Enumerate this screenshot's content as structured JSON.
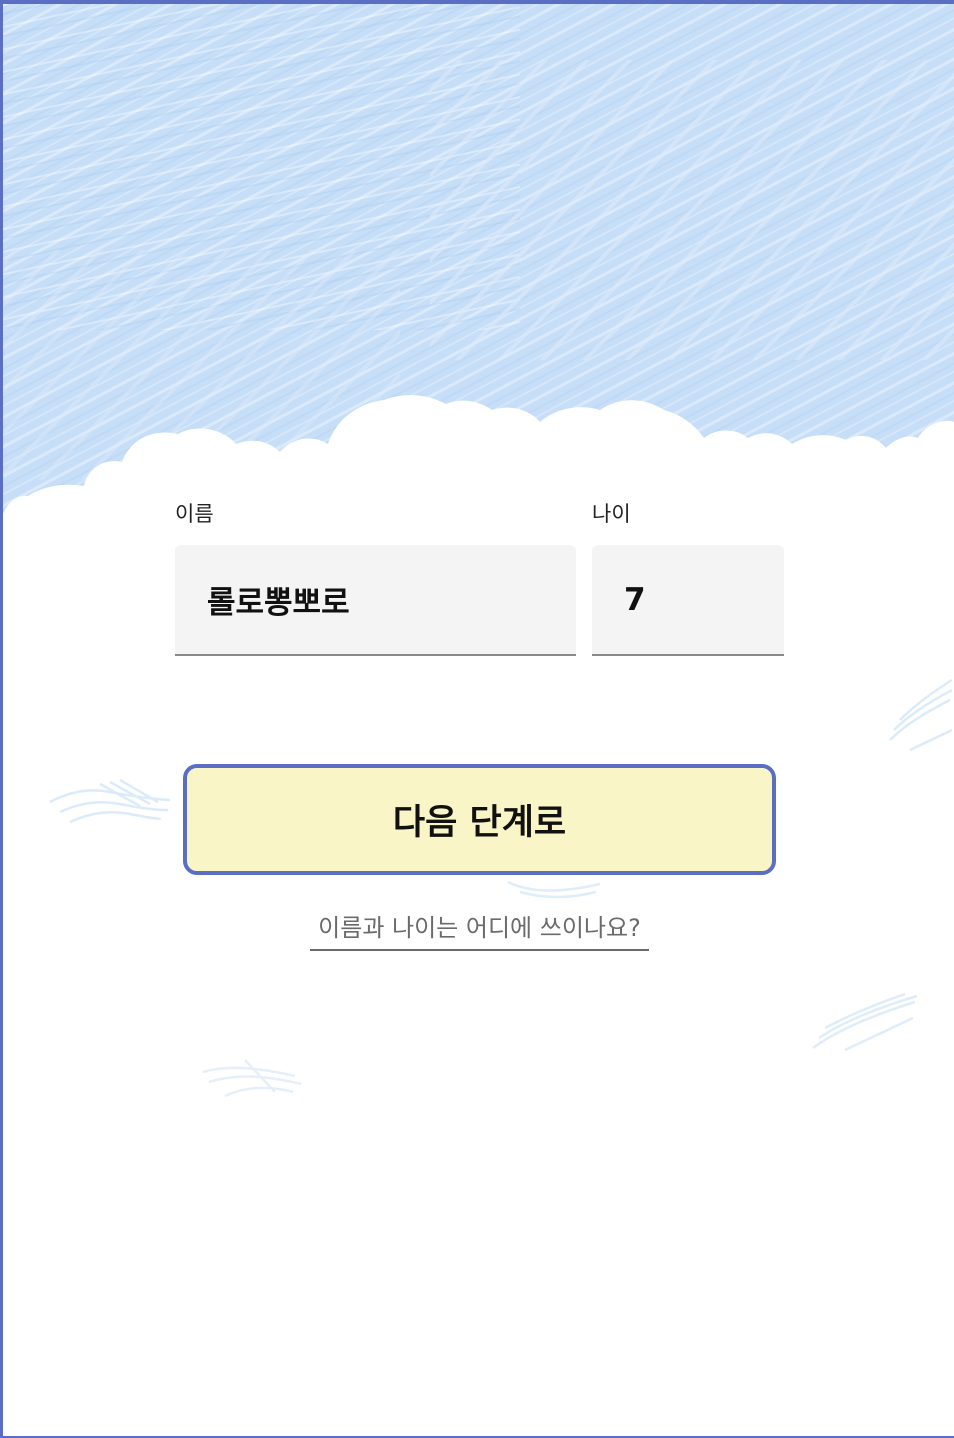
{
  "form": {
    "name_label": "이름",
    "name_value": "롤로뽕뽀로",
    "age_label": "나이",
    "age_value": "7"
  },
  "actions": {
    "next_label": "다음 단계로",
    "help_link": "이름과 나이는 어디에 쓰이나요?"
  },
  "colors": {
    "sky": "#c6def7",
    "frame_border": "#5a6fc4",
    "button_fill": "#faf5c6",
    "field_fill": "#f4f4f4"
  }
}
